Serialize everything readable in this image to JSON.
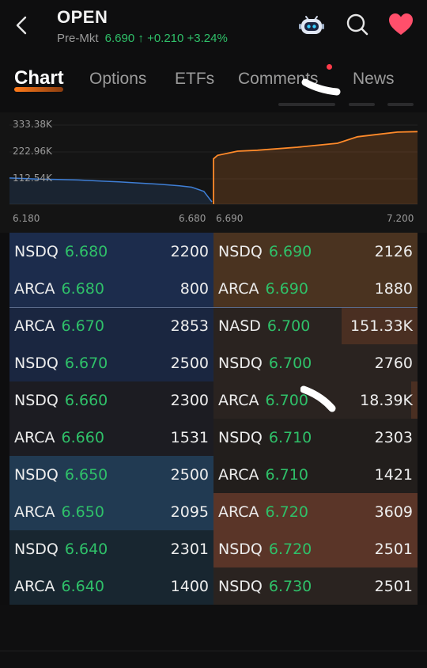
{
  "header": {
    "ticker": "OPEN",
    "premkt_label": "Pre-Mkt",
    "price": "6.690",
    "change": "+0.210",
    "change_pct": "+3.24%"
  },
  "tabs": [
    {
      "label": "Chart",
      "active": true
    },
    {
      "label": "Options"
    },
    {
      "label": "ETFs"
    },
    {
      "label": "Comments"
    },
    {
      "label": "News"
    }
  ],
  "chart": {
    "y_labels": [
      "333.38K",
      "222.96K",
      "112.54K"
    ],
    "x_labels": [
      "6.180",
      "6.680",
      "6.690",
      "7.200"
    ],
    "bid_color": "#3f7fd6",
    "ask_color": "#ff8a2a"
  },
  "chart_data": {
    "type": "area",
    "ylim": [
      0,
      333380
    ],
    "series": [
      {
        "x": [
          6.18,
          6.25,
          6.3,
          6.35,
          6.4,
          6.45,
          6.5,
          6.55,
          6.6,
          6.63,
          6.66,
          6.68
        ],
        "values": [
          112540,
          108000,
          106000,
          104000,
          100000,
          96000,
          91000,
          86000,
          79000,
          73000,
          55000,
          10000
        ]
      },
      {
        "x": [
          6.69,
          6.7,
          6.75,
          6.8,
          6.9,
          7.0,
          7.05,
          7.1,
          7.15,
          7.2
        ],
        "values": [
          195000,
          210000,
          228000,
          232000,
          245000,
          262000,
          290000,
          300000,
          310000,
          312000
        ]
      }
    ]
  },
  "book": {
    "bids": [
      {
        "exchange": "NSDQ",
        "price": "6.680",
        "size": "2200"
      },
      {
        "exchange": "ARCA",
        "price": "6.680",
        "size": "800"
      },
      {
        "exchange": "ARCA",
        "price": "6.670",
        "size": "2853"
      },
      {
        "exchange": "NSDQ",
        "price": "6.670",
        "size": "2500"
      },
      {
        "exchange": "NSDQ",
        "price": "6.660",
        "size": "2300"
      },
      {
        "exchange": "ARCA",
        "price": "6.660",
        "size": "1531"
      },
      {
        "exchange": "NSDQ",
        "price": "6.650",
        "size": "2500"
      },
      {
        "exchange": "ARCA",
        "price": "6.650",
        "size": "2095"
      },
      {
        "exchange": "NSDQ",
        "price": "6.640",
        "size": "2301"
      },
      {
        "exchange": "ARCA",
        "price": "6.640",
        "size": "1400"
      }
    ],
    "asks": [
      {
        "exchange": "NSDQ",
        "price": "6.690",
        "size": "2126"
      },
      {
        "exchange": "ARCA",
        "price": "6.690",
        "size": "1880"
      },
      {
        "exchange": "NASD",
        "price": "6.700",
        "size": "151.33K"
      },
      {
        "exchange": "NSDQ",
        "price": "6.700",
        "size": "2760"
      },
      {
        "exchange": "ARCA",
        "price": "6.700",
        "size": "18.39K"
      },
      {
        "exchange": "NSDQ",
        "price": "6.710",
        "size": "2303"
      },
      {
        "exchange": "ARCA",
        "price": "6.710",
        "size": "1421"
      },
      {
        "exchange": "ARCA",
        "price": "6.720",
        "size": "3609"
      },
      {
        "exchange": "NSDQ",
        "price": "6.720",
        "size": "2501"
      },
      {
        "exchange": "NSDQ",
        "price": "6.730",
        "size": "2501"
      }
    ],
    "bid_colors": [
      "#1c2c4c",
      "#1c2c4c",
      "#1a2640",
      "#1a2640",
      "#1c1c22",
      "#1c1c22",
      "#213a52",
      "#213a52",
      "#182630",
      "#182630"
    ],
    "ask_colors": [
      "#4a3320",
      "#4a3320",
      "#2a2320",
      "#2a2320",
      "#2a2320",
      "#221e1c",
      "#221e1c",
      "#5a3528",
      "#5a3528",
      "#2a2320"
    ]
  }
}
